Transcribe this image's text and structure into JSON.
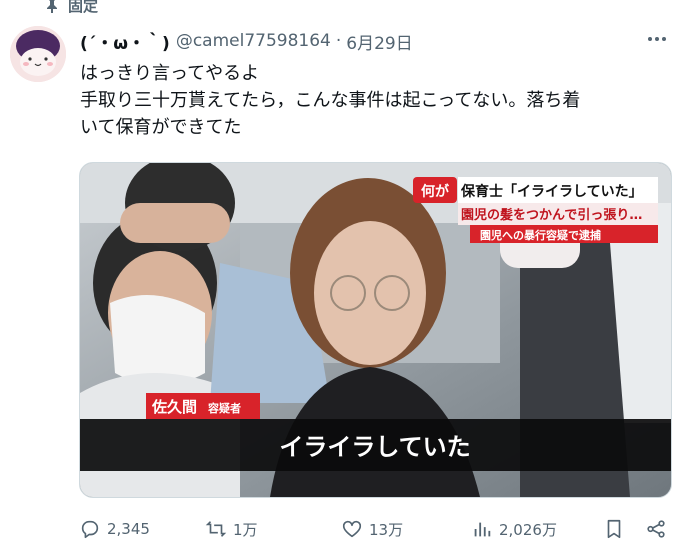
{
  "pinned": {
    "label": "固定"
  },
  "tweet": {
    "display_name": "(´・ω・｀)",
    "handle": "@camel77598164",
    "separator": "·",
    "date": "6月29日",
    "text_lines": [
      "はっきり言ってやるよ",
      "手取り三十万貰えてたら，こんな事件は起こってない。落ち着",
      "いて保育ができてた"
    ]
  },
  "media": {
    "caption_badge": "何が",
    "caption_line1": "保育士「イライラしていた」",
    "caption_line2": "園児の髪をつかんで引っ張り…",
    "caption_line3": "園児への暴行容疑で逮捕",
    "name_tag_main": "佐久間",
    "name_tag_suffix": "容疑者",
    "subtitle": "イライラしていた"
  },
  "actions": {
    "replies": "2,345",
    "reposts": "1万",
    "likes": "13万",
    "views": "2,026万"
  },
  "colors": {
    "muted": "#536471",
    "text": "#0f1419",
    "caption_red": "#d8232a"
  },
  "icons": [
    "pin-icon",
    "more-icon",
    "reply-icon",
    "repost-icon",
    "like-icon",
    "views-icon",
    "bookmark-icon",
    "share-icon"
  ]
}
